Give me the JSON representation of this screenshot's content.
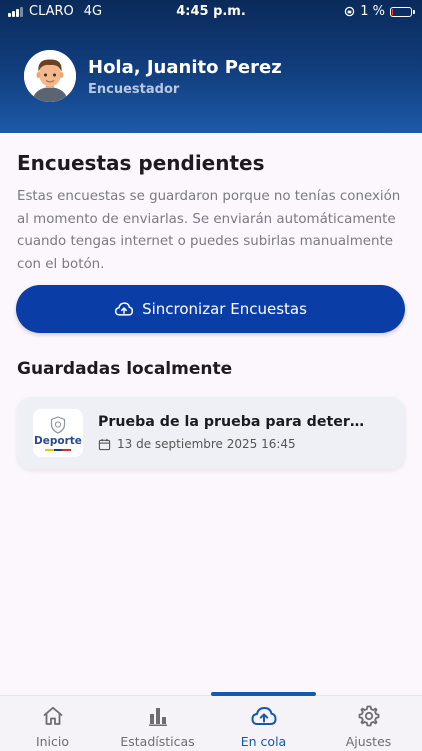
{
  "status_bar": {
    "carrier": "CLARO",
    "network": "4G",
    "time": "4:45 p.m.",
    "battery": "1 %"
  },
  "header": {
    "greeting": "Hola, Juanito Perez",
    "role": "Encuestador"
  },
  "main": {
    "title": "Encuestas pendientes",
    "description": "Estas encuestas se guardaron porque no tenías conexión al momento de enviarlas. Se enviarán automáticamente cuando tengas internet o puedes subirlas manualmente con el botón.",
    "sync_button_label": "Sincronizar Encuestas",
    "section_title": "Guardadas localmente",
    "items": [
      {
        "logo_text": "Deporte",
        "title": "Prueba de la prueba para deter…",
        "date": "13 de septiembre 2025 16:45"
      }
    ]
  },
  "bottom_nav": {
    "active": "En cola",
    "items": [
      {
        "label": "Inicio",
        "icon": "home-icon"
      },
      {
        "label": "Estadísticas",
        "icon": "bar-chart-icon"
      },
      {
        "label": "En cola",
        "icon": "cloud-upload-icon"
      },
      {
        "label": "Ajustes",
        "icon": "gear-icon"
      }
    ]
  },
  "colors": {
    "primary": "#0b3da6",
    "header": "#123f80",
    "active_nav": "#1558b0"
  }
}
